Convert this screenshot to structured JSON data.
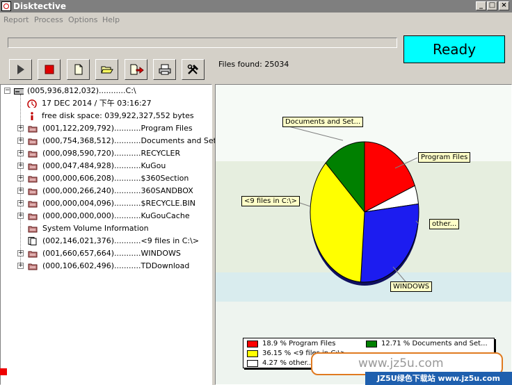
{
  "window": {
    "title": "Disktective"
  },
  "menu": [
    "Report",
    "Process",
    "Options",
    "Help"
  ],
  "status": {
    "text": "Ready",
    "color": "#00ffff"
  },
  "progress": {
    "value": 0
  },
  "files_found": "Files found: 25034",
  "toolbar": {
    "buttons": [
      {
        "name": "play",
        "icon": "play-icon"
      },
      {
        "name": "stop",
        "icon": "stop-icon"
      },
      {
        "name": "new-report",
        "icon": "new-document-icon"
      },
      {
        "name": "open",
        "icon": "open-folder-icon"
      },
      {
        "name": "export",
        "icon": "export-icon"
      },
      {
        "name": "print",
        "icon": "printer-icon"
      },
      {
        "name": "tools",
        "icon": "tools-icon"
      }
    ]
  },
  "tree": {
    "root": "(005,936,812,032)...........C:\\",
    "date": "17 DEC 2014 / 下午 03:16:27",
    "free_space": "free disk space:  039,922,327,552  bytes",
    "items": [
      {
        "text": "(001,122,209,792)...........Program Files",
        "expander": "+",
        "icon": "folder-icon"
      },
      {
        "text": "(000,754,368,512)...........Documents and Settings",
        "expander": "+",
        "icon": "folder-icon"
      },
      {
        "text": "(000,098,590,720)...........RECYCLER",
        "expander": "+",
        "icon": "folder-icon"
      },
      {
        "text": "(000,047,484,928)...........KuGou",
        "expander": "+",
        "icon": "folder-icon"
      },
      {
        "text": "(000,000,606,208)...........$360Section",
        "expander": "+",
        "icon": "folder-icon"
      },
      {
        "text": "(000,000,266,240)...........360SANDBOX",
        "expander": "+",
        "icon": "folder-icon"
      },
      {
        "text": "(000,000,004,096)...........$RECYCLE.BIN",
        "expander": "+",
        "icon": "folder-icon"
      },
      {
        "text": "(000,000,000,000)...........KuGouCache",
        "expander": "+",
        "icon": "folder-icon"
      },
      {
        "text": "System Volume Information",
        "expander": "",
        "icon": "folder-icon"
      },
      {
        "text": "(002,146,021,376)...........<9 files in C:\\>",
        "expander": "",
        "icon": "files-icon"
      },
      {
        "text": "(001,660,657,664)...........WINDOWS",
        "expander": "+",
        "icon": "folder-icon"
      },
      {
        "text": "(000,106,602,496)...........TDDownload",
        "expander": "+",
        "icon": "folder-icon"
      }
    ]
  },
  "chart_data": {
    "type": "pie",
    "slices": [
      {
        "name": "Program Files",
        "value": 18.9,
        "color": "#ff0000",
        "callout": "Program Files",
        "legend": "18.9 % Program Files"
      },
      {
        "name": "other",
        "value": 4.27,
        "color": "#ffffff",
        "callout": "other...",
        "legend": "4.27 % other..."
      },
      {
        "name": "WINDOWS",
        "value": 27.97,
        "color": "#1c1cf0",
        "callout": "WINDOWS",
        "legend": ""
      },
      {
        "name": "<9 files in C:\\>",
        "value": 36.15,
        "color": "#ffff00",
        "callout": "<9 files in C:\\>",
        "legend": "36.15 % <9 files in C:\\>"
      },
      {
        "name": "Documents and Settings",
        "value": 12.71,
        "color": "#008000",
        "callout": "Documents and Set...",
        "legend": "12.71 % Documents and Set..."
      }
    ],
    "legend_placement": "bottom"
  },
  "watermark": {
    "text": "www.jz5u.com",
    "banner": "JZ5U绿色下载站 www.jz5u.com"
  }
}
